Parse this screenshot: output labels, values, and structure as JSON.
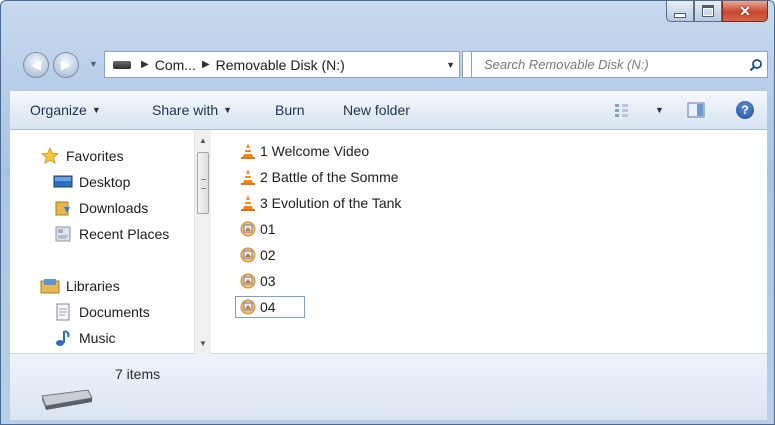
{
  "window": {
    "caption_buttons": {
      "minimize": "minimize",
      "maximize": "maximize",
      "close": "close"
    }
  },
  "address": {
    "crumbs": [
      "Com...",
      "Removable Disk (N:)"
    ]
  },
  "search": {
    "placeholder": "Search Removable Disk (N:)"
  },
  "toolbar": {
    "organize": "Organize",
    "share_with": "Share with",
    "burn": "Burn",
    "new_folder": "New folder"
  },
  "sidebar": {
    "items": [
      {
        "label": "Favorites",
        "icon": "star-icon"
      },
      {
        "label": "Desktop",
        "icon": "desktop-icon"
      },
      {
        "label": "Downloads",
        "icon": "downloads-icon"
      },
      {
        "label": "Recent Places",
        "icon": "recent-places-icon"
      },
      {
        "label": "Libraries",
        "icon": "libraries-icon"
      },
      {
        "label": "Documents",
        "icon": "documents-icon"
      },
      {
        "label": "Music",
        "icon": "music-icon"
      }
    ]
  },
  "files": [
    {
      "name": "1 Welcome Video",
      "icon": "vlc-cone-icon"
    },
    {
      "name": "2 Battle of the Somme",
      "icon": "vlc-cone-icon"
    },
    {
      "name": "3 Evolution of the Tank",
      "icon": "vlc-cone-icon"
    },
    {
      "name": "01",
      "icon": "image-file-icon"
    },
    {
      "name": "02",
      "icon": "image-file-icon"
    },
    {
      "name": "03",
      "icon": "image-file-icon"
    },
    {
      "name": "04",
      "icon": "image-file-icon",
      "selected": true
    }
  ],
  "status": {
    "item_count": "7 items"
  },
  "colors": {
    "chrome": "#a9c4e3",
    "close_button": "#c8482f",
    "selection_border": "#7da2ce",
    "vlc_orange": "#f08a16"
  }
}
